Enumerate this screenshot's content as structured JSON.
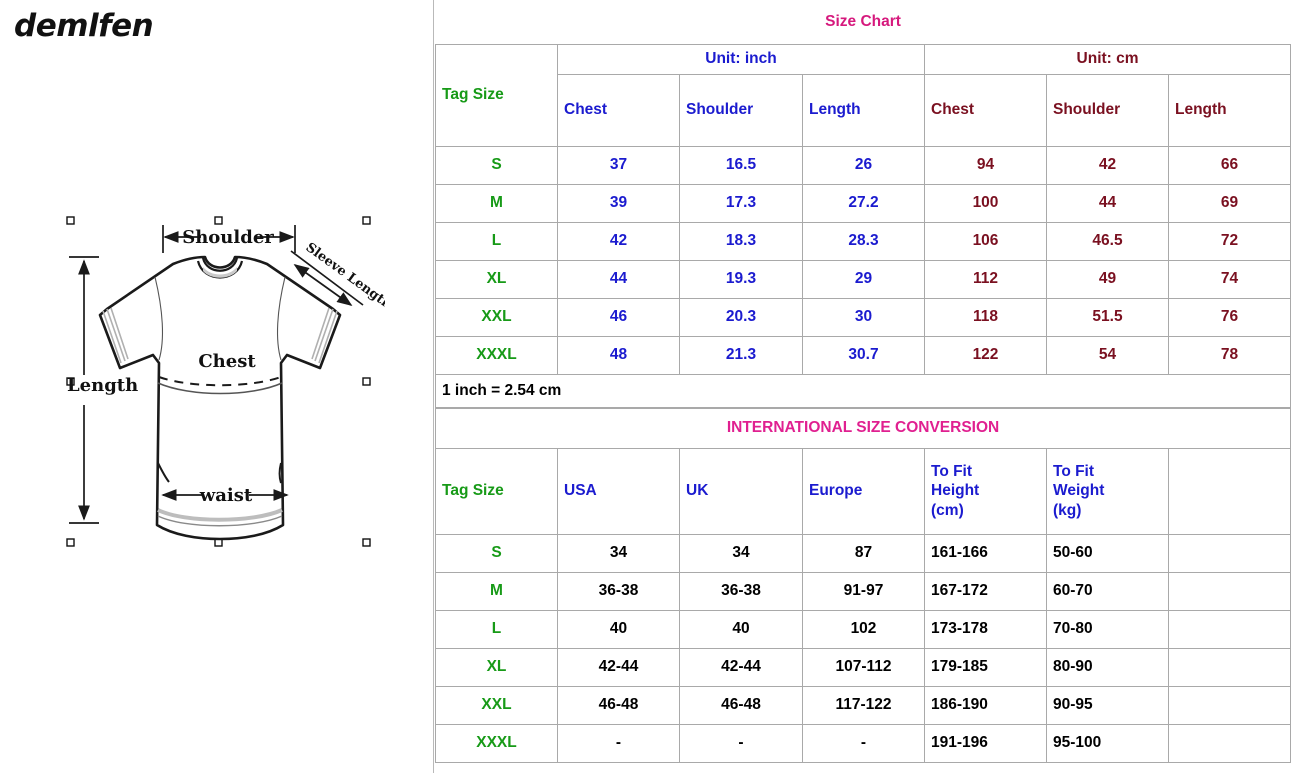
{
  "brand": {
    "logo_text": "demlfen"
  },
  "diagram": {
    "name": "tshirt-measurement-diagram",
    "labels": {
      "shoulder": "Shoulder",
      "sleeve_length": "Sleeve Length",
      "chest": "Chest",
      "length": "Length",
      "waist": "waist"
    }
  },
  "colors": {
    "title_pink": "#d6197d",
    "intl_pink": "#e02090",
    "green": "#179a17",
    "blue": "#1b1bcf",
    "maroon": "#7a1020",
    "black": "#000000",
    "border": "#a9a9a9"
  },
  "size_chart": {
    "title": "Size Chart",
    "tag_size_header": "Tag Size",
    "unit_groups": [
      {
        "label": "Unit: inch",
        "columns": [
          "Chest",
          "Shoulder",
          "Length"
        ]
      },
      {
        "label": "Unit: cm",
        "columns": [
          "Chest",
          "Shoulder",
          "Length"
        ]
      }
    ],
    "rows": [
      {
        "size": "S",
        "inch": {
          "chest": "37",
          "shoulder": "16.5",
          "length": "26"
        },
        "cm": {
          "chest": "94",
          "shoulder": "42",
          "length": "66"
        }
      },
      {
        "size": "M",
        "inch": {
          "chest": "39",
          "shoulder": "17.3",
          "length": "27.2"
        },
        "cm": {
          "chest": "100",
          "shoulder": "44",
          "length": "69"
        }
      },
      {
        "size": "L",
        "inch": {
          "chest": "42",
          "shoulder": "18.3",
          "length": "28.3"
        },
        "cm": {
          "chest": "106",
          "shoulder": "46.5",
          "length": "72"
        }
      },
      {
        "size": "XL",
        "inch": {
          "chest": "44",
          "shoulder": "19.3",
          "length": "29"
        },
        "cm": {
          "chest": "112",
          "shoulder": "49",
          "length": "74"
        }
      },
      {
        "size": "XXL",
        "inch": {
          "chest": "46",
          "shoulder": "20.3",
          "length": "30"
        },
        "cm": {
          "chest": "118",
          "shoulder": "51.5",
          "length": "76"
        }
      },
      {
        "size": "XXXL",
        "inch": {
          "chest": "48",
          "shoulder": "21.3",
          "length": "30.7"
        },
        "cm": {
          "chest": "122",
          "shoulder": "54",
          "length": "78"
        }
      }
    ],
    "note": "1 inch = 2.54 cm"
  },
  "international": {
    "title": "INTERNATIONAL SIZE CONVERSION",
    "headers": {
      "tag_size": "Tag Size",
      "usa": "USA",
      "uk": "UK",
      "europe": "Europe",
      "height_l1": "To Fit",
      "height_l2": "Height",
      "height_l3": "(cm)",
      "weight_l1": "To Fit",
      "weight_l2": "Weight",
      "weight_l3": "(kg)",
      "extra": ""
    },
    "rows": [
      {
        "size": "S",
        "usa": "34",
        "uk": "34",
        "europe": "87",
        "height": "161-166",
        "weight": "50-60",
        "extra": ""
      },
      {
        "size": "M",
        "usa": "36-38",
        "uk": "36-38",
        "europe": "91-97",
        "height": "167-172",
        "weight": "60-70",
        "extra": ""
      },
      {
        "size": "L",
        "usa": "40",
        "uk": "40",
        "europe": "102",
        "height": "173-178",
        "weight": "70-80",
        "extra": ""
      },
      {
        "size": "XL",
        "usa": "42-44",
        "uk": "42-44",
        "europe": "107-112",
        "height": "179-185",
        "weight": "80-90",
        "extra": ""
      },
      {
        "size": "XXL",
        "usa": "46-48",
        "uk": "46-48",
        "europe": "117-122",
        "height": "186-190",
        "weight": "90-95",
        "extra": ""
      },
      {
        "size": "XXXL",
        "usa": "-",
        "uk": "-",
        "europe": "-",
        "height": "191-196",
        "weight": "95-100",
        "extra": ""
      }
    ]
  }
}
